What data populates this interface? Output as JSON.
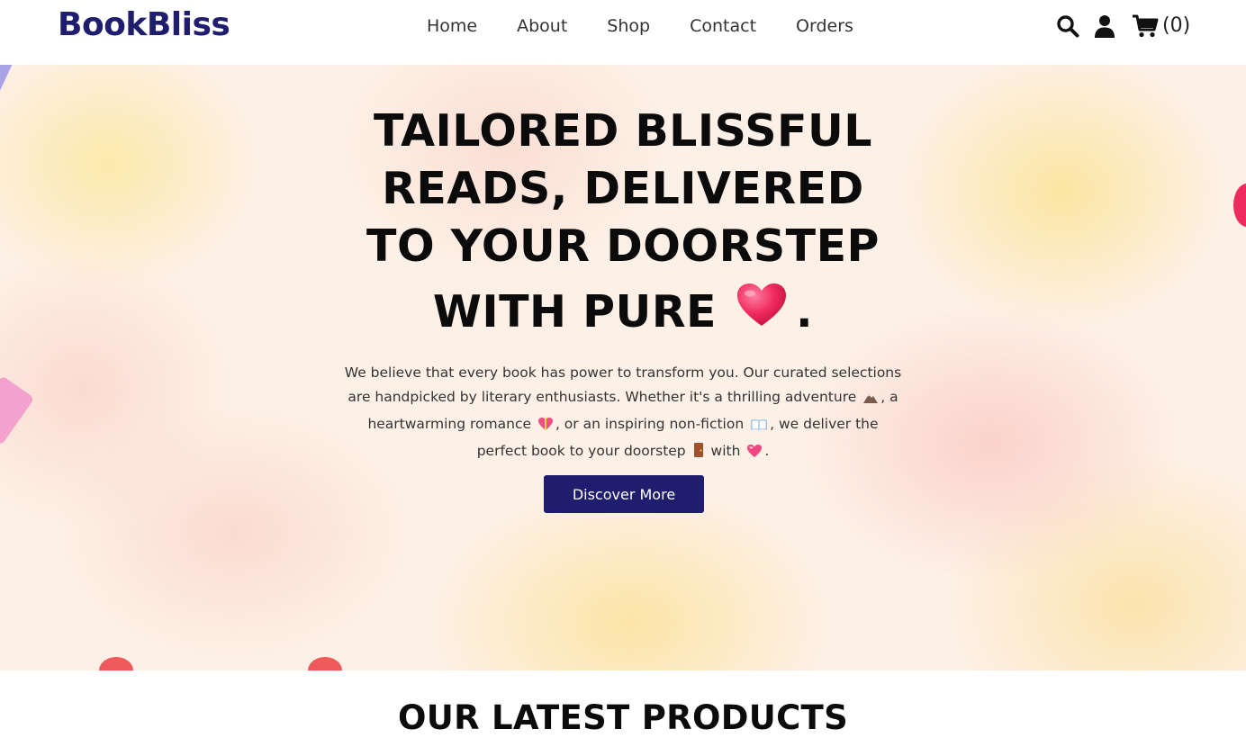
{
  "header": {
    "logo": "BookBliss",
    "nav": [
      {
        "label": "Home"
      },
      {
        "label": "About"
      },
      {
        "label": "Shop"
      },
      {
        "label": "Contact"
      },
      {
        "label": "Orders"
      }
    ],
    "icons": [
      "search-icon",
      "user-icon",
      "cart-icon"
    ],
    "cart_count": "(0)"
  },
  "hero": {
    "title_lines": [
      "TAILORED BLISSFUL",
      "READS, DELIVERED",
      "TO YOUR DOORSTEP"
    ],
    "title_last": "WITH PURE",
    "title_end": ".",
    "title_emoji": "heart-emoji",
    "text_parts": [
      "We believe that every book has power to transform you. Our curated selections are handpicked by literary enthusiasts. Whether it's a thrilling adventure",
      ", a heartwarming romance",
      ", or an inspiring non-fiction",
      ", we deliver the perfect book to your doorstep",
      " with",
      "."
    ],
    "text_emojis": [
      "mountain-emoji",
      "heart-gift-emoji",
      "open-book-emoji",
      "door-emoji",
      "pink-heart-emoji"
    ],
    "button_label": "Discover More"
  },
  "section": {
    "title": "OUR LATEST PRODUCTS"
  },
  "colors": {
    "brand": "#1f1d6e",
    "heart": "#ef2a5e"
  }
}
